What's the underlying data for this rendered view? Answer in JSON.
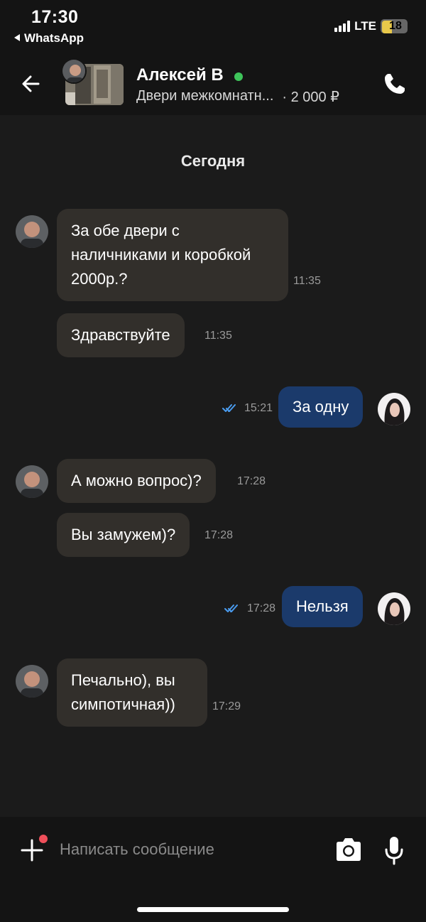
{
  "status_bar": {
    "time": "17:30",
    "back_app": "WhatsApp",
    "network": "LTE",
    "battery": "18",
    "battery_color": "#e8c84a"
  },
  "header": {
    "contact_name": "Алексей В",
    "online_color": "#3ec45a",
    "listing_title": "Двери межкомнатн...",
    "listing_price": "· 2 000 ₽",
    "icons": [
      "back-arrow-icon",
      "phone-icon"
    ]
  },
  "chat": {
    "date_label": "Сегодня",
    "messages": [
      {
        "side": "in",
        "text": "За обе двери с наличниками и коробкой 2000р.?",
        "time": "11:35"
      },
      {
        "side": "in",
        "text": "Здравствуйте",
        "time": "11:35"
      },
      {
        "side": "out",
        "text": "За одну",
        "time": "15:21",
        "status": "read"
      },
      {
        "side": "in",
        "text": "А можно вопрос)?",
        "time": "17:28"
      },
      {
        "side": "in",
        "text": "Вы замужем)?",
        "time": "17:28"
      },
      {
        "side": "out",
        "text": "Нельзя",
        "time": "17:28",
        "status": "read"
      },
      {
        "side": "in",
        "text": "Печально), вы симпотичная))",
        "time": "17:29"
      }
    ]
  },
  "composer": {
    "placeholder": "Написать сообщение",
    "icons": [
      "plus-icon",
      "camera-icon",
      "microphone-icon"
    ],
    "notification_dot_color": "#ef4f5a"
  },
  "colors": {
    "incoming_bubble": "#322f2b",
    "outgoing_bubble": "#1b3a6b",
    "read_ticks": "#4a9cf0"
  }
}
